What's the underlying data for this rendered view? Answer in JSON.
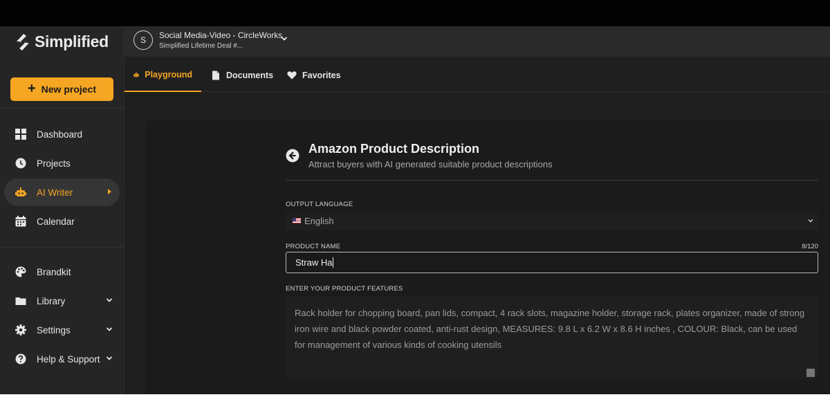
{
  "brand": {
    "name": "Simplified"
  },
  "sidebar": {
    "new_project_label": "New project",
    "items": [
      {
        "label": "Dashboard",
        "icon": "dashboard-icon"
      },
      {
        "label": "Projects",
        "icon": "clock-icon"
      },
      {
        "label": "AI Writer",
        "icon": "robot-icon",
        "active": true
      },
      {
        "label": "Calendar",
        "icon": "calendar-icon"
      },
      {
        "label": "Brandkit",
        "icon": "palette-icon"
      },
      {
        "label": "Library",
        "icon": "folder-icon"
      },
      {
        "label": "Settings",
        "icon": "gear-icon"
      },
      {
        "label": "Help & Support",
        "icon": "help-icon"
      }
    ]
  },
  "workspace": {
    "initial": "S",
    "name": "Social Media-Video - CircleWorks",
    "subtitle": "Simplified Lifetime Deal #..."
  },
  "tabs": [
    {
      "label": "Playground",
      "icon": "robot-icon",
      "active": true
    },
    {
      "label": "Documents",
      "icon": "document-icon"
    },
    {
      "label": "Favorites",
      "icon": "heart-icon"
    }
  ],
  "form": {
    "title": "Amazon Product Description",
    "subtitle": "Attract buyers with AI generated suitable product descriptions",
    "output_language": {
      "label": "OUTPUT LANGUAGE",
      "value": "English"
    },
    "product_name": {
      "label": "PRODUCT NAME",
      "value": "Straw Ha",
      "counter": "8/120"
    },
    "product_features": {
      "label": "ENTER YOUR PRODUCT FEATURES",
      "value": "Rack holder for chopping board, pan lids, compact, 4 rack slots, magazine holder, storage rack, plates organizer, made of strong iron wire and black powder coated, anti-rust design, MEASURES: 9.8 L x 6.2 W x 8.6 H inches , COLOUR: Black, can be used for management of various kinds of cooking utensils"
    }
  },
  "colors": {
    "accent": "#f5a623",
    "background": "#1f1f1f",
    "sidebar": "#252525"
  }
}
